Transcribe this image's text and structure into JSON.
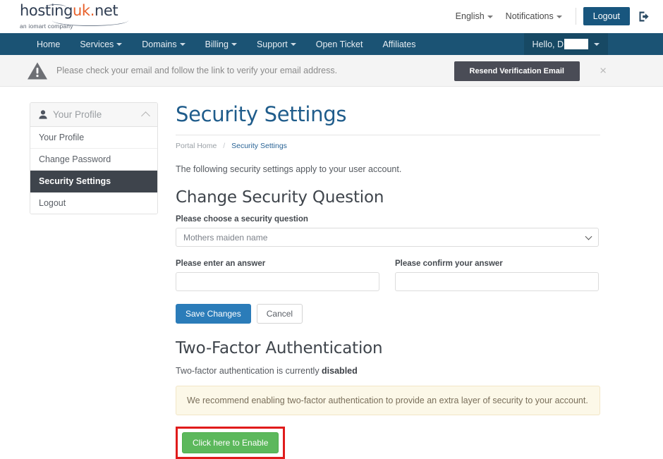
{
  "header": {
    "logo": {
      "part1": "hosting",
      "uk": "uk",
      "dot": ".",
      "part2": "net",
      "tagline": "an iomart company"
    },
    "language": "English",
    "notifications": "Notifications",
    "logout_button": "Logout",
    "signout_icon": "signout-icon"
  },
  "nav": {
    "items": [
      {
        "label": "Home",
        "has_caret": false
      },
      {
        "label": "Services",
        "has_caret": true
      },
      {
        "label": "Domains",
        "has_caret": true
      },
      {
        "label": "Billing",
        "has_caret": true
      },
      {
        "label": "Support",
        "has_caret": true
      },
      {
        "label": "Open Ticket",
        "has_caret": false
      },
      {
        "label": "Affiliates",
        "has_caret": false
      }
    ],
    "user_greeting": "Hello, D"
  },
  "alert": {
    "icon": "warning-triangle-icon",
    "message": "Please check your email and follow the link to verify your email address.",
    "resend_button": "Resend Verification Email",
    "close_icon": "×"
  },
  "sidebar": {
    "header": "Your Profile",
    "header_icon": "person-icon",
    "collapse_icon": "chevron-up-icon",
    "items": [
      {
        "label": "Your Profile",
        "active": false
      },
      {
        "label": "Change Password",
        "active": false
      },
      {
        "label": "Security Settings",
        "active": true
      },
      {
        "label": "Logout",
        "active": false
      }
    ]
  },
  "main": {
    "page_title": "Security Settings",
    "breadcrumb": {
      "home": "Portal Home",
      "separator": "/",
      "current": "Security Settings"
    },
    "intro": "The following security settings apply to your user account.",
    "security_question": {
      "heading": "Change Security Question",
      "select_label": "Please choose a security question",
      "selected_option": "Mothers maiden name",
      "answer_label": "Please enter an answer",
      "answer_value": "",
      "confirm_label": "Please confirm your answer",
      "confirm_value": "",
      "save_button": "Save Changes",
      "cancel_button": "Cancel"
    },
    "two_factor": {
      "heading": "Two-Factor Authentication",
      "status_prefix": "Two-factor authentication is currently ",
      "status_value": "disabled",
      "notice": "We recommend enabling two-factor authentication to provide an extra layer of security to your account.",
      "enable_button": "Click here to Enable"
    }
  },
  "colors": {
    "navbar": "#1b5374",
    "title_blue": "#1f5c8b",
    "primary_button": "#2b7cb9",
    "success_button": "#5cb85c",
    "highlight_outline": "#e01b1b",
    "logo_orange": "#e8622c",
    "notice_bg": "#fcf8e8",
    "active_sidebar": "#3e444c"
  }
}
